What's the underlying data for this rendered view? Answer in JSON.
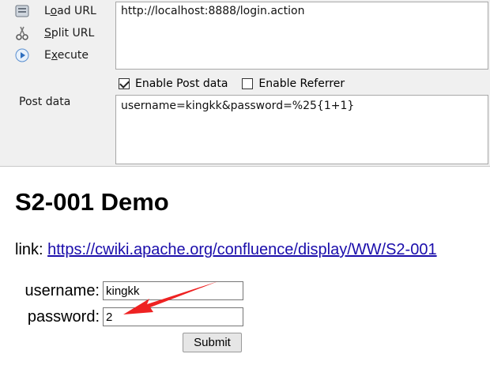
{
  "toolbar": {
    "load_url": "Load URL",
    "split_url": "Split URL",
    "execute": "Execute",
    "url_value": "http://localhost:8888/login.action",
    "enable_post": "Enable Post data",
    "enable_post_checked": true,
    "enable_referrer": "Enable Referrer",
    "enable_referrer_checked": false,
    "post_label": "Post data",
    "post_value": "username=kingkk&password=%25{1+1}"
  },
  "page": {
    "title": "S2-001 Demo",
    "link_prefix": "link: ",
    "link_text": "https://cwiki.apache.org/confluence/display/WW/S2-001",
    "username_label": "username:",
    "username_value": "kingkk",
    "password_label": "password:",
    "password_value": "2",
    "submit_label": "Submit"
  },
  "colors": {
    "annotation_arrow": "#ee2222",
    "link": "#1a0dab"
  },
  "icons": [
    "load-url-icon",
    "split-url-icon",
    "execute-icon",
    "annotation-arrow"
  ]
}
